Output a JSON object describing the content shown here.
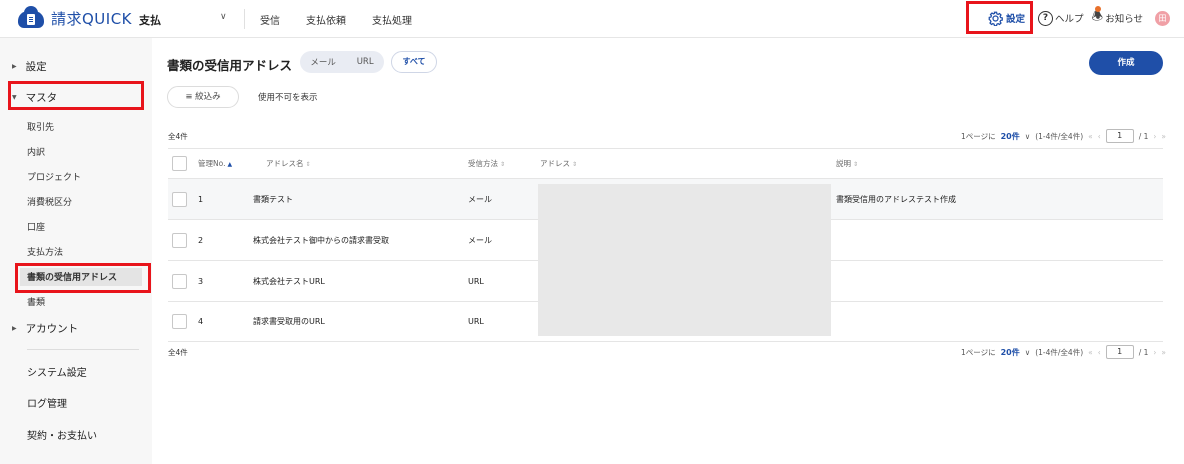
{
  "header": {
    "app_name": "請求QUICK",
    "module": "支払",
    "nav": [
      "受信",
      "支払依頼",
      "支払処理"
    ],
    "settings_label": "設定",
    "help_label": "ヘルプ",
    "notice_label": "お知らせ",
    "avatar_text": "田"
  },
  "sidebar": {
    "settings": "設定",
    "master": "マスタ",
    "master_items": [
      "取引先",
      "内訳",
      "プロジェクト",
      "消費税区分",
      "口座",
      "支払方法",
      "書類の受信用アドレス",
      "書類"
    ],
    "account": "アカウント",
    "system_settings": "システム設定",
    "log_management": "ログ管理",
    "contract": "契約・お支払い"
  },
  "main": {
    "title": "書類の受信用アドレス",
    "filter_pills": [
      "メール",
      "URL"
    ],
    "all_pill": "すべて",
    "create_button": "作成",
    "filter_button": "絞込み",
    "show_unusable": "使用不可を表示",
    "count_label": "全4件",
    "pager": {
      "per_page_prefix": "1ページに",
      "per_page_value": "20件",
      "range": "(1-4件/全4件)",
      "current_page": "1",
      "total_pages": "/ 1"
    },
    "table": {
      "headers": {
        "id": "管理No.",
        "name": "アドレス名",
        "method": "受信方法",
        "address": "アドレス",
        "description": "説明"
      },
      "rows": [
        {
          "id": "1",
          "name": "書類テスト",
          "method": "メール",
          "description": "書類受信用のアドレステスト作成"
        },
        {
          "id": "2",
          "name": "株式会社テスト御中からの請求書受取",
          "method": "メール",
          "description": ""
        },
        {
          "id": "3",
          "name": "株式会社テストURL",
          "method": "URL",
          "description": ""
        },
        {
          "id": "4",
          "name": "請求書受取用のURL",
          "method": "URL",
          "description": ""
        }
      ]
    }
  },
  "colors": {
    "brand": "#1f4fa8",
    "highlight_box": "#e8141b",
    "redaction": "#e8e8e8"
  }
}
